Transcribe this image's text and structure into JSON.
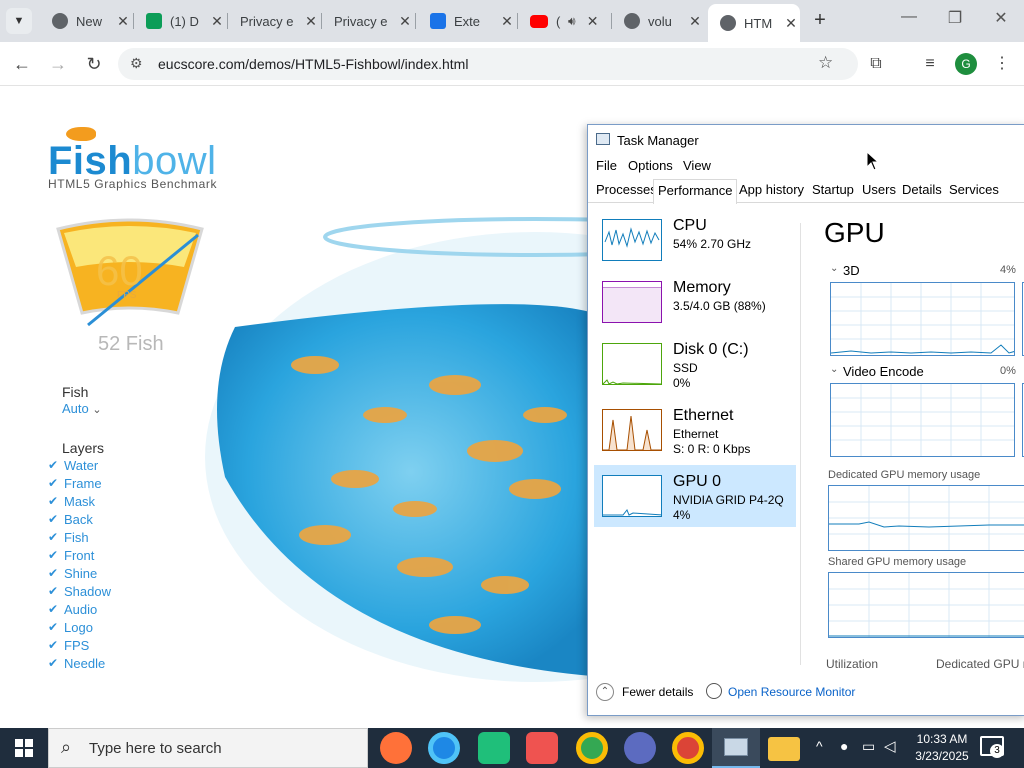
{
  "browser": {
    "tabs": [
      {
        "title": "New",
        "color": "#5f6368"
      },
      {
        "title": "(1) D",
        "color": "#0c9d58"
      },
      {
        "title": "Privacy e",
        "color": "#888888"
      },
      {
        "title": "Privacy e",
        "color": "#888888"
      },
      {
        "title": "Exte",
        "color": "#1a73e8"
      },
      {
        "title": "(",
        "color": "#ff0000"
      },
      {
        "title": "volu",
        "color": "#5f6368"
      },
      {
        "title": "HTM",
        "color": "#5f6368"
      }
    ],
    "new_tab_symbol": "+",
    "url": "eucscore.com/demos/HTML5-Fishbowl/index.html",
    "profile_initial": "G"
  },
  "fishbowl": {
    "logo_part1": "Fish",
    "logo_part2": "bowl",
    "subtitle": "HTML5 Graphics Benchmark",
    "fps_value": "60",
    "fps_unit": "FPS",
    "fish_count": "52 Fish",
    "fish_label": "Fish",
    "fish_value": "Auto",
    "layers_title": "Layers",
    "layers": [
      "Water",
      "Frame",
      "Mask",
      "Back",
      "Fish",
      "Front",
      "Shine",
      "Shadow",
      "Audio",
      "Logo",
      "FPS",
      "Needle"
    ]
  },
  "task_manager": {
    "title": "Task Manager",
    "menu": [
      "File",
      "Options",
      "View"
    ],
    "tabs": [
      "Processes",
      "Performance",
      "App history",
      "Startup",
      "Users",
      "Details",
      "Services"
    ],
    "perf_items": [
      {
        "name": "CPU",
        "l2": "54% 2.70 GHz",
        "l3": "",
        "color": "#117dbb"
      },
      {
        "name": "Memory",
        "l2": "3.5/4.0 GB (88%)",
        "l3": "",
        "color": "#8b12ae"
      },
      {
        "name": "Disk 0 (C:)",
        "l2": "SSD",
        "l3": "0%",
        "color": "#4da60c"
      },
      {
        "name": "Ethernet",
        "l2": "Ethernet",
        "l3": "S: 0 R: 0 Kbps",
        "color": "#a74f01"
      },
      {
        "name": "GPU 0",
        "l2": "NVIDIA GRID P4-2Q",
        "l3": "4%",
        "color": "#117dbb"
      }
    ],
    "gpu_heading": "GPU",
    "graph1_label": "3D",
    "graph1_pct": "4%",
    "graph2_label": "Video Encode",
    "graph2_pct": "0%",
    "dedicated_label": "Dedicated GPU memory usage",
    "shared_label": "Shared GPU memory usage",
    "bottom_left": "Utilization",
    "bottom_right": "Dedicated GPU m",
    "fewer_details": "Fewer details",
    "open_monitor": "Open Resource Monitor"
  },
  "taskbar": {
    "search_placeholder": "Type here to search",
    "time": "10:33 AM",
    "date": "3/23/2025",
    "notification_count": "3"
  }
}
